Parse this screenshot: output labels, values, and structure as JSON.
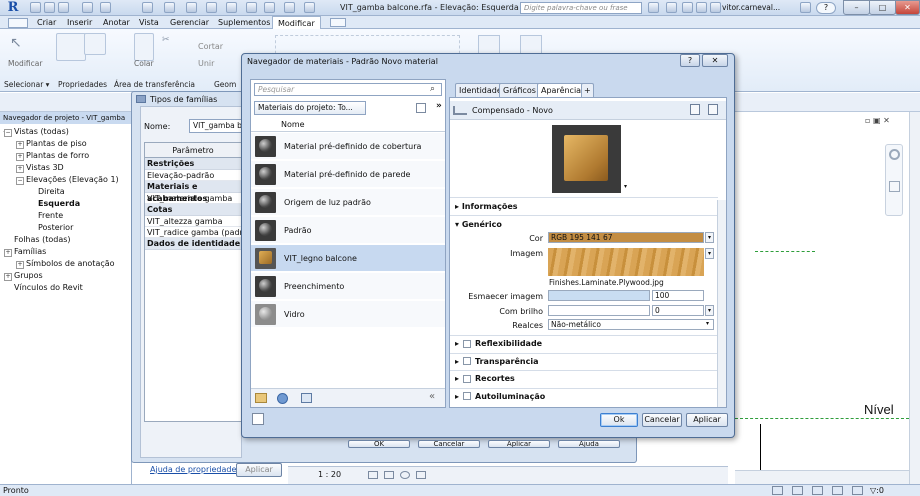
{
  "titlebar": {
    "logo": "R",
    "doc_title": "VIT_gamba balcone.rfa - Elevação: Esquerda",
    "search_placeholder": "Digite palavra-chave ou frase",
    "user": "vitor.carneval...",
    "help": "?",
    "minimize": "–",
    "maximize": "□",
    "close": "✕"
  },
  "ribbon": {
    "tabs": [
      "Criar",
      "Inserir",
      "Anotar",
      "Vista",
      "Gerenciar",
      "Suplementos",
      "Modificar"
    ],
    "buttons": {
      "modify": "Modificar",
      "paste": "Colar",
      "cut": "Cortar",
      "join": "Unir"
    },
    "panels": [
      "Selecionar ▾",
      "Propriedades",
      "Área de transferência",
      "Geom"
    ]
  },
  "browser": {
    "header": "Navegador de projeto - VIT_gamba ...",
    "items": [
      {
        "label": "Vistas (todas)",
        "level": 0,
        "exp": "−"
      },
      {
        "label": "Plantas de piso",
        "level": 1,
        "exp": "+"
      },
      {
        "label": "Plantas de forro",
        "level": 1,
        "exp": "+"
      },
      {
        "label": "Vistas 3D",
        "level": 1,
        "exp": "+"
      },
      {
        "label": "Elevações (Elevação 1)",
        "level": 1,
        "exp": "−"
      },
      {
        "label": "Direita",
        "level": 2,
        "exp": ""
      },
      {
        "label": "Esquerda",
        "level": 2,
        "exp": "",
        "bold": true
      },
      {
        "label": "Frente",
        "level": 2,
        "exp": ""
      },
      {
        "label": "Posterior",
        "level": 2,
        "exp": ""
      },
      {
        "label": "Folhas (todas)",
        "level": 0,
        "exp": ""
      },
      {
        "label": "Famílias",
        "level": 0,
        "exp": "+"
      },
      {
        "label": "Símbolos de anotação",
        "level": 1,
        "exp": "+"
      },
      {
        "label": "Grupos",
        "level": 0,
        "exp": "+"
      },
      {
        "label": "Vínculos do Revit",
        "level": 0,
        "exp": ""
      }
    ]
  },
  "family_dialog": {
    "title": "Tipos de famílias",
    "name_label": "Nome:",
    "name_value": "VIT_gamba balc",
    "col_param": "Parâmetro",
    "groups": [
      {
        "name": "Restrições",
        "rows": [
          "Elevação-padrão"
        ]
      },
      {
        "name": "Materiais e acabamentos",
        "rows": [
          "VIT_materiale gamba"
        ]
      },
      {
        "name": "Cotas",
        "rows": [
          "VIT_altezza gamba",
          "VIT_radice gamba (padrão)"
        ]
      },
      {
        "name": "Dados de identidade",
        "rows": []
      }
    ],
    "bottom_buttons": [
      "OK",
      "Cancelar",
      "Aplicar",
      "Ajuda"
    ],
    "help_link": "Ajuda de propriedades",
    "apply": "Aplicar"
  },
  "material_dialog": {
    "title": "Navegador de materiais - Padrão Novo material",
    "search_placeholder": "Pesquisar",
    "library": "Materiais do projeto: To...",
    "col_name": "Nome",
    "materials": [
      {
        "name": "Material pré-definido de cobertura",
        "type": "default"
      },
      {
        "name": "Material pré-definido de parede",
        "type": "default"
      },
      {
        "name": "Origem de luz padrão",
        "type": "default"
      },
      {
        "name": "Padrão",
        "type": "default"
      },
      {
        "name": "VIT_legno balcone",
        "type": "wood",
        "selected": true
      },
      {
        "name": "Preenchimento",
        "type": "default"
      },
      {
        "name": "Vidro",
        "type": "glass"
      }
    ],
    "tabs": [
      "Identidade",
      "Gráficos",
      "Aparência",
      "+"
    ],
    "active_tab": "Aparência",
    "asset_name": "Compensado - Novo",
    "sections": {
      "info": "Informações",
      "generic": "Genérico"
    },
    "props": {
      "color_label": "Cor",
      "color_value": "RGB 195 141 67",
      "color_hex": "#c38d43",
      "image_label": "Imagem",
      "image_file": "Finishes.Laminate.Plywood.jpg",
      "fade_label": "Esmaecer imagem",
      "fade_value": "100",
      "gloss_label": "Com brilho",
      "gloss_value": "0",
      "highlights_label": "Realces",
      "highlights_value": "Não-metálico"
    },
    "collapsed": [
      "Reflexibilidade",
      "Transparência",
      "Recortes",
      "Autoiluminação"
    ],
    "buttons": {
      "ok": "Ok",
      "cancel": "Cancelar",
      "apply": "Aplicar"
    }
  },
  "canvas": {
    "level_label": "Nível"
  },
  "status": {
    "text": "Pronto",
    "scale": "1 : 20",
    "filter": ":0"
  }
}
